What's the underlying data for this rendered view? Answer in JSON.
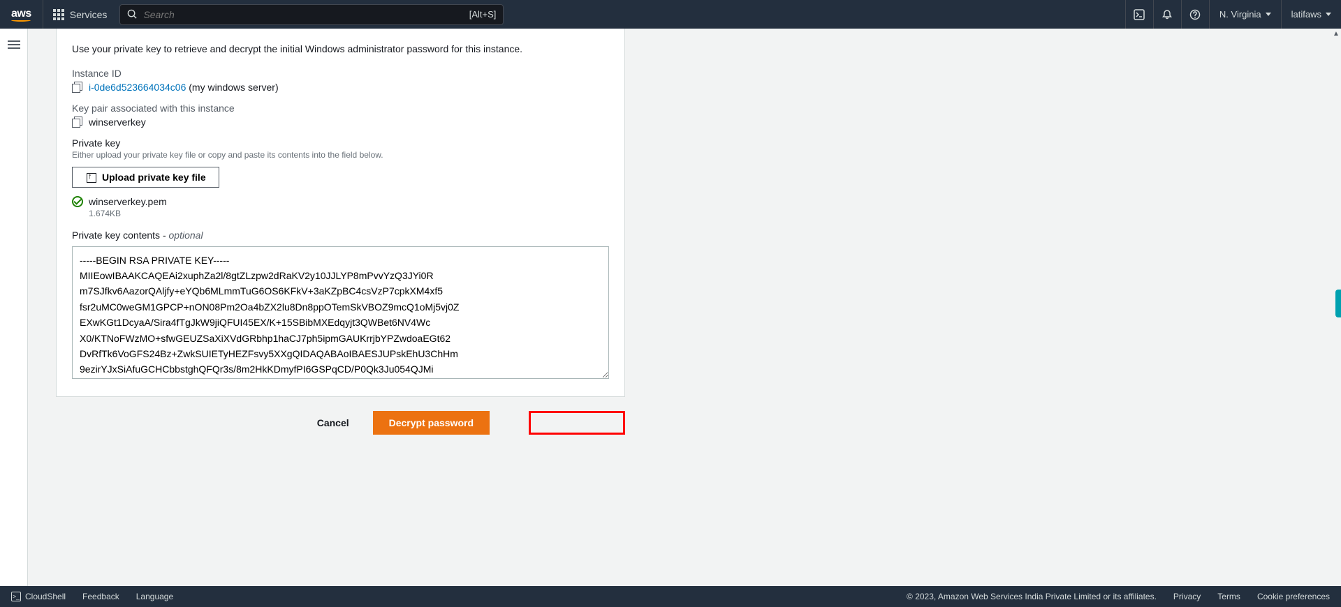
{
  "header": {
    "logo": "aws",
    "services_label": "Services",
    "search_placeholder": "Search",
    "search_hint": "[Alt+S]",
    "region": "N. Virginia",
    "user": "latifaws"
  },
  "main": {
    "intro": "Use your private key to retrieve and decrypt the initial Windows administrator password for this instance.",
    "instance_id_label": "Instance ID",
    "instance_id": "i-0de6d523664034c06",
    "instance_name_suffix": " (my windows server)",
    "keypair_label": "Key pair associated with this instance",
    "keypair_name": "winserverkey",
    "private_key_label": "Private key",
    "private_key_desc": "Either upload your private key file or copy and paste its contents into the field below.",
    "upload_button": "Upload private key file",
    "uploaded_file": "winserverkey.pem",
    "uploaded_size": "1.674KB",
    "pk_contents_label": "Private key contents - ",
    "pk_contents_optional": "optional",
    "pk_value": "-----BEGIN RSA PRIVATE KEY-----\nMIIEowIBAAKCAQEAi2xuphZa2l/8gtZLzpw2dRaKV2y10JJLYP8mPvvYzQ3JYi0R\nm7SJfkv6AazorQAljfy+eYQb6MLmmTuG6OS6KFkV+3aKZpBC4csVzP7cpkXM4xf5\nfsr2uMC0weGM1GPCP+nON08Pm2Oa4bZX2lu8Dn8ppOTemSkVBOZ9mcQ1oMj5vj0Z\nEXwKGt1DcyaA/Sira4fTgJkW9jiQFUI45EX/K+15SBibMXEdqyjt3QWBet6NV4Wc\nX0/KTNoFWzMO+sfwGEUZSaXiXVdGRbhp1haCJ7ph5ipmGAUKrrjbYPZwdoaEGt62\nDvRfTk6VoGFS24Bz+ZwkSUIETyHEZFsvy5XXgQIDAQABAoIBAESJUPskEhU3ChHm\n9ezirYJxSiAfuGCHCbbstghQFQr3s/8m2HkKDmyfPI6GSPqCD/P0Qk3Ju054QJMi"
  },
  "actions": {
    "cancel": "Cancel",
    "decrypt": "Decrypt password"
  },
  "footer": {
    "cloudshell": "CloudShell",
    "feedback": "Feedback",
    "language": "Language",
    "copyright": "© 2023, Amazon Web Services India Private Limited or its affiliates.",
    "privacy": "Privacy",
    "terms": "Terms",
    "cookies": "Cookie preferences"
  }
}
